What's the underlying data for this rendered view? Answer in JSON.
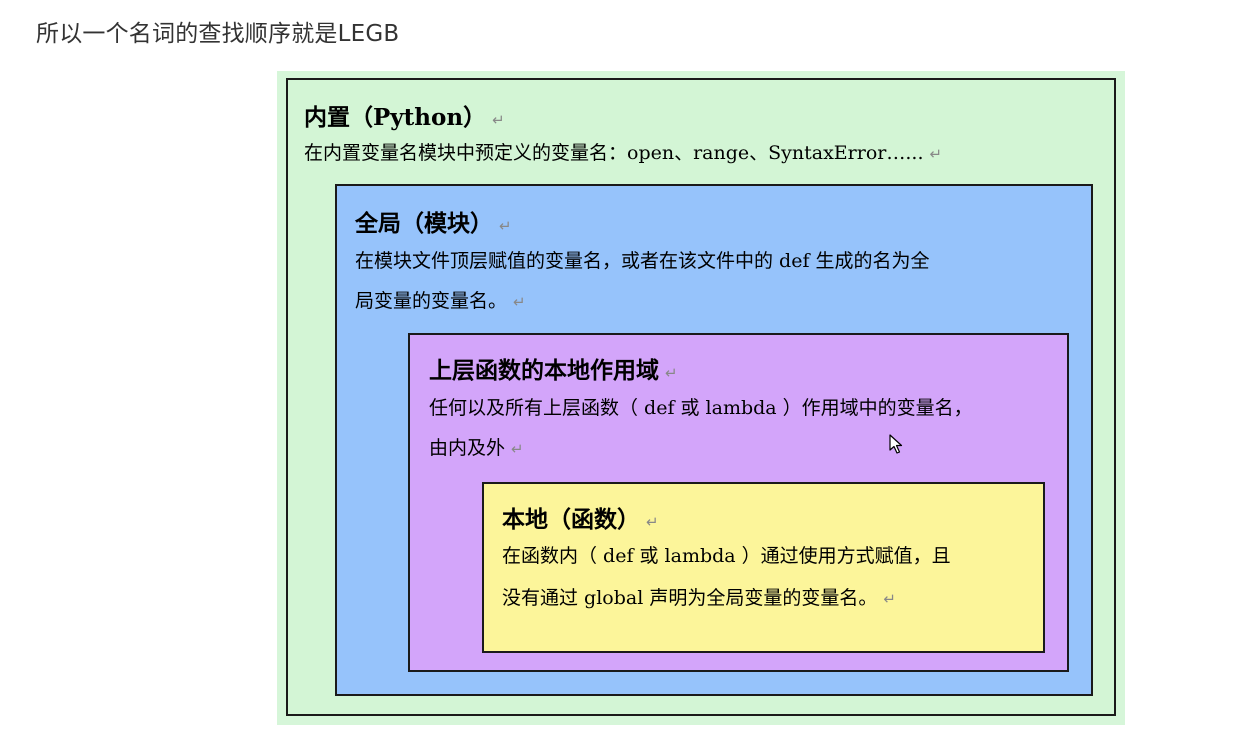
{
  "heading": "所以一个名词的查找顺序就是LEGB",
  "return_mark": "↵",
  "builtin": {
    "title": "内置（Python）",
    "desc_line1": "在内置变量名模块中预定义的变量名：open、range、SyntaxError…...",
    "color": "#d3f5d5"
  },
  "global": {
    "title": "全局（模块）",
    "desc_line1": "在模块文件顶层赋值的变量名，或者在该文件中的 def 生成的名为全",
    "desc_line2": "局变量的变量名。",
    "color": "#96c3fb"
  },
  "enclosing": {
    "title": "上层函数的本地作用域",
    "desc_line1": "任何以及所有上层函数（ def 或 lambda ）作用域中的变量名，",
    "desc_line2": "由内及外",
    "color": "#d3a5fa"
  },
  "local": {
    "title": "本地（函数）",
    "desc_line1": "在函数内（ def 或 lambda ）通过使用方式赋值，且",
    "desc_line2": "没有通过 global 声明为全局变量的变量名。",
    "color": "#fcf59a"
  }
}
